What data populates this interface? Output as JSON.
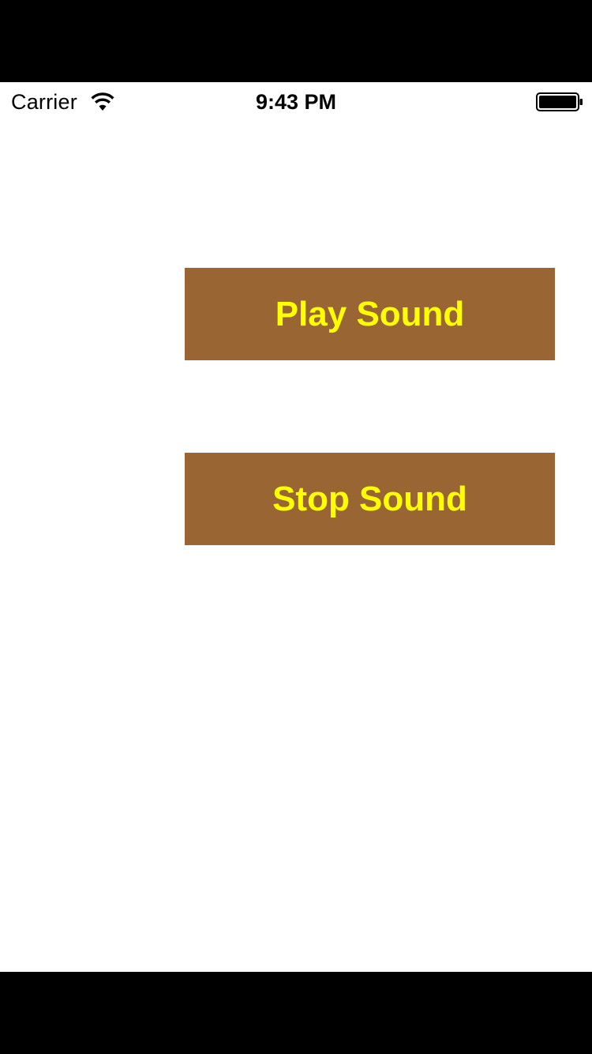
{
  "status_bar": {
    "carrier": "Carrier",
    "time": "9:43 PM",
    "wifi_icon": "wifi-icon",
    "battery_icon": "battery-icon"
  },
  "buttons": {
    "play_label": "Play Sound",
    "stop_label": "Stop Sound"
  },
  "colors": {
    "button_background": "#996633",
    "button_text": "#ffff00",
    "screen_background": "#ffffff",
    "letterbox": "#000000"
  }
}
